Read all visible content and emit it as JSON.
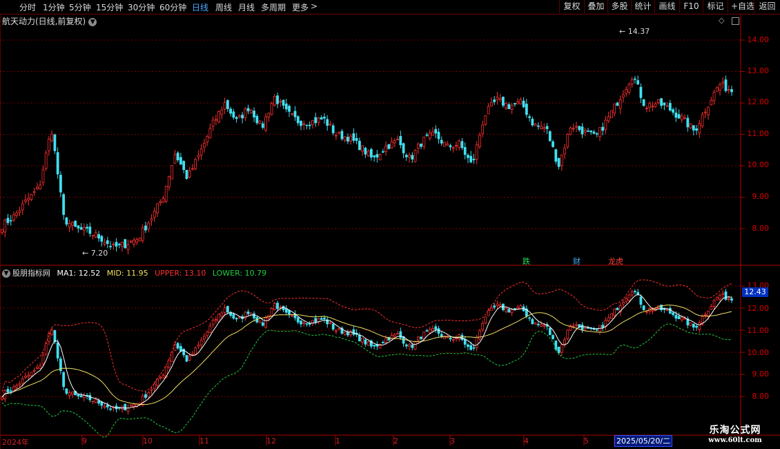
{
  "toolbar": {
    "periods": [
      "分时",
      "1分钟",
      "5分钟",
      "15分钟",
      "30分钟",
      "60分钟",
      "日线",
      "周线",
      "月线",
      "多周期",
      "更多"
    ],
    "active_period": "日线",
    "more_arrow": ">",
    "right_buttons": [
      "复权",
      "叠加",
      "多股",
      "统计",
      "画线",
      "F10",
      "标记",
      "+自选",
      "返回"
    ]
  },
  "main_chart": {
    "title": "航天动力(日线,前复权)",
    "high_label": "14.37",
    "low_label": "7.20",
    "events": [
      {
        "text": "跌",
        "color": "#20e060"
      },
      {
        "text": "财",
        "color": "#40b0ff"
      },
      {
        "text": "龙虎",
        "color": "#ff4040"
      }
    ]
  },
  "indicator": {
    "name": "股朋指标网",
    "ma1_label": "MA1: 12.52",
    "mid_label": "MID: 11.95",
    "upper_label": "UPPER: 13.10",
    "lower_label": "LOWER: 10.79",
    "ma1_color": "#ffffff",
    "mid_color": "#f0e060",
    "upper_color": "#ff3030",
    "lower_color": "#20d040",
    "current_price_tag": "12.43"
  },
  "axes": {
    "main_prices": [
      "14.00",
      "13.00",
      "12.00",
      "11.00",
      "10.00",
      "9.00",
      "8.00"
    ],
    "indicator_prices": [
      "13.00",
      "12.00",
      "11.00",
      "10.00",
      "9.00",
      "8.00"
    ],
    "dates": [
      "2024年",
      "9",
      "10",
      "11",
      "12",
      "1",
      "2",
      "3",
      "4",
      "5"
    ],
    "cursor_date": "2025/05/20/二"
  },
  "colors": {
    "up": "#ff3030",
    "down": "#40e0f0",
    "grid": "#7a0000",
    "frame": "#b00000"
  },
  "chart_data": {
    "type": "candlestick",
    "value_range": [
      7.2,
      14.37
    ],
    "x": [
      "2024年",
      "9",
      "10",
      "11",
      "12",
      "1",
      "2",
      "3",
      "4",
      "5"
    ],
    "close": [
      8.1,
      8.4,
      8.9,
      9.3,
      11.2,
      8.3,
      8.0,
      7.9,
      7.7,
      7.4,
      7.5,
      7.7,
      8.3,
      9.0,
      10.4,
      9.6,
      10.4,
      11.3,
      12.0,
      11.4,
      11.9,
      11.2,
      12.2,
      11.7,
      11.4,
      11.4,
      11.5,
      11.0,
      10.9,
      10.6,
      10.2,
      10.6,
      10.8,
      10.2,
      10.8,
      11.0,
      10.6,
      10.7,
      10.0,
      11.6,
      12.1,
      11.9,
      12.0,
      11.3,
      11.2,
      10.0,
      11.3,
      11.1,
      10.9,
      11.5,
      12.2,
      12.9,
      11.9,
      12.0,
      11.8,
      11.5,
      11.1,
      11.9,
      12.6,
      12.4
    ],
    "highs_lows_note": ""
  }
}
